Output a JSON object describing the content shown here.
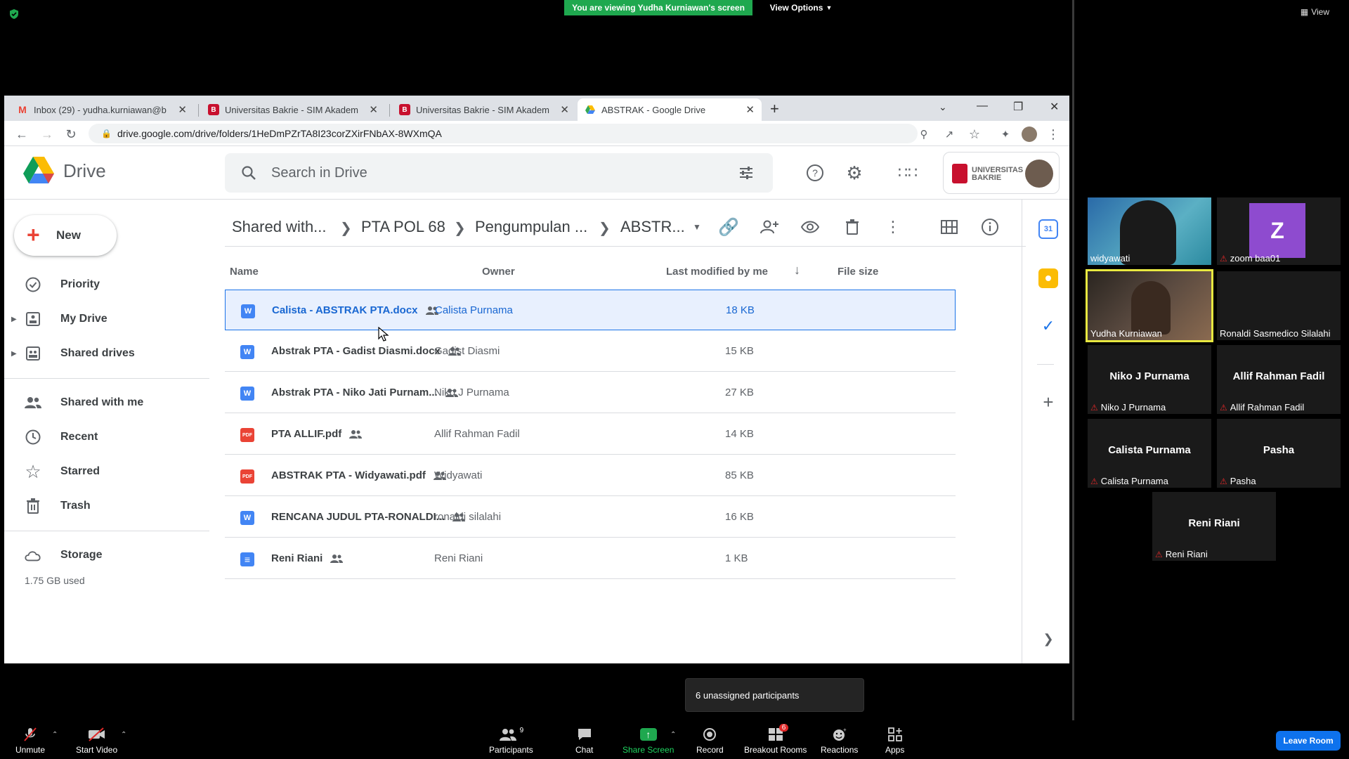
{
  "zoom": {
    "banner": "You are viewing Yudha Kurniawan's screen",
    "view_options": "View Options",
    "view_label": "View",
    "tooltip": "6 unassigned participants",
    "bottom": {
      "unmute": "Unmute",
      "start_video": "Start Video",
      "participants": "Participants",
      "participants_count": "9",
      "chat": "Chat",
      "share_screen": "Share Screen",
      "record": "Record",
      "breakout_rooms": "Breakout Rooms",
      "breakout_badge": "6",
      "reactions": "Reactions",
      "apps": "Apps",
      "leave_room": "Leave Room"
    },
    "participants": [
      {
        "name": "widyawati"
      },
      {
        "name": "zoom baa01",
        "avatar_letter": "Z"
      },
      {
        "name": "Yudha Kurniawan"
      },
      {
        "name": "Ronaldi Sasmedico Silalahi"
      },
      {
        "name": "Niko J Purnama"
      },
      {
        "name": "Allif Rahman Fadil"
      },
      {
        "name": "Calista Purnama"
      },
      {
        "name": "Pasha"
      },
      {
        "name": "Reni Riani"
      }
    ]
  },
  "browser": {
    "tabs": [
      {
        "title": "Inbox (29) - yudha.kurniawan@b",
        "favicon": "gmail"
      },
      {
        "title": "Universitas Bakrie - SIM Akadem",
        "favicon": "bakrie"
      },
      {
        "title": "Universitas Bakrie - SIM Akadem",
        "favicon": "bakrie"
      },
      {
        "title": "ABSTRAK - Google Drive",
        "favicon": "drive",
        "active": true
      }
    ],
    "url": "drive.google.com/drive/folders/1HeDmPZrTA8I23corZXirFNbAX-8WXmQA"
  },
  "drive": {
    "title": "Drive",
    "search_placeholder": "Search in Drive",
    "new_label": "New",
    "nav": [
      {
        "label": "Priority",
        "icon": "priority-icon"
      },
      {
        "label": "My Drive",
        "icon": "my-drive-icon"
      },
      {
        "label": "Shared drives",
        "icon": "shared-drives-icon"
      },
      {
        "label": "Shared with me",
        "icon": "shared-with-me-icon"
      },
      {
        "label": "Recent",
        "icon": "recent-icon"
      },
      {
        "label": "Starred",
        "icon": "star-icon"
      },
      {
        "label": "Trash",
        "icon": "trash-icon"
      },
      {
        "label": "Storage",
        "icon": "cloud-icon"
      }
    ],
    "storage_used": "1.75 GB used",
    "breadcrumb": [
      "Shared with...",
      "PTA POL 68",
      "Pengumpulan ...",
      "ABSTR..."
    ],
    "columns": {
      "name": "Name",
      "owner": "Owner",
      "modified": "Last modified by me",
      "size": "File size"
    },
    "files": [
      {
        "name": "Calista - ABSTRAK PTA.docx",
        "owner": "Calista Purnama",
        "size": "18 KB",
        "type": "W",
        "selected": true
      },
      {
        "name": "Abstrak PTA - Gadist Diasmi.docx",
        "owner": "Gadist Diasmi",
        "size": "15 KB",
        "type": "W"
      },
      {
        "name": "Abstrak PTA - Niko Jati Purnam...",
        "owner": "Niko J Purnama",
        "size": "27 KB",
        "type": "W"
      },
      {
        "name": "PTA ALLIF.pdf",
        "owner": "Allif Rahman Fadil",
        "size": "14 KB",
        "type": "PDF"
      },
      {
        "name": "ABSTRAK PTA - Widyawati.pdf",
        "owner": "Widyawati",
        "size": "85 KB",
        "type": "PDF"
      },
      {
        "name": "RENCANA JUDUL PTA-RONALDI...",
        "owner": "ronaldi silalahi",
        "size": "16 KB",
        "type": "W"
      },
      {
        "name": "Reni Riani",
        "owner": "Reni Riani",
        "size": "1 KB",
        "type": "DOC"
      }
    ],
    "university_label": "UNIVERSITAS BAKRIE"
  },
  "colors": {
    "zoom_green": "#1fa84f",
    "drive_blue": "#1a73e8",
    "word_blue": "#4285f4",
    "pdf_red": "#ea4335",
    "leave_blue": "#0e72ed"
  }
}
